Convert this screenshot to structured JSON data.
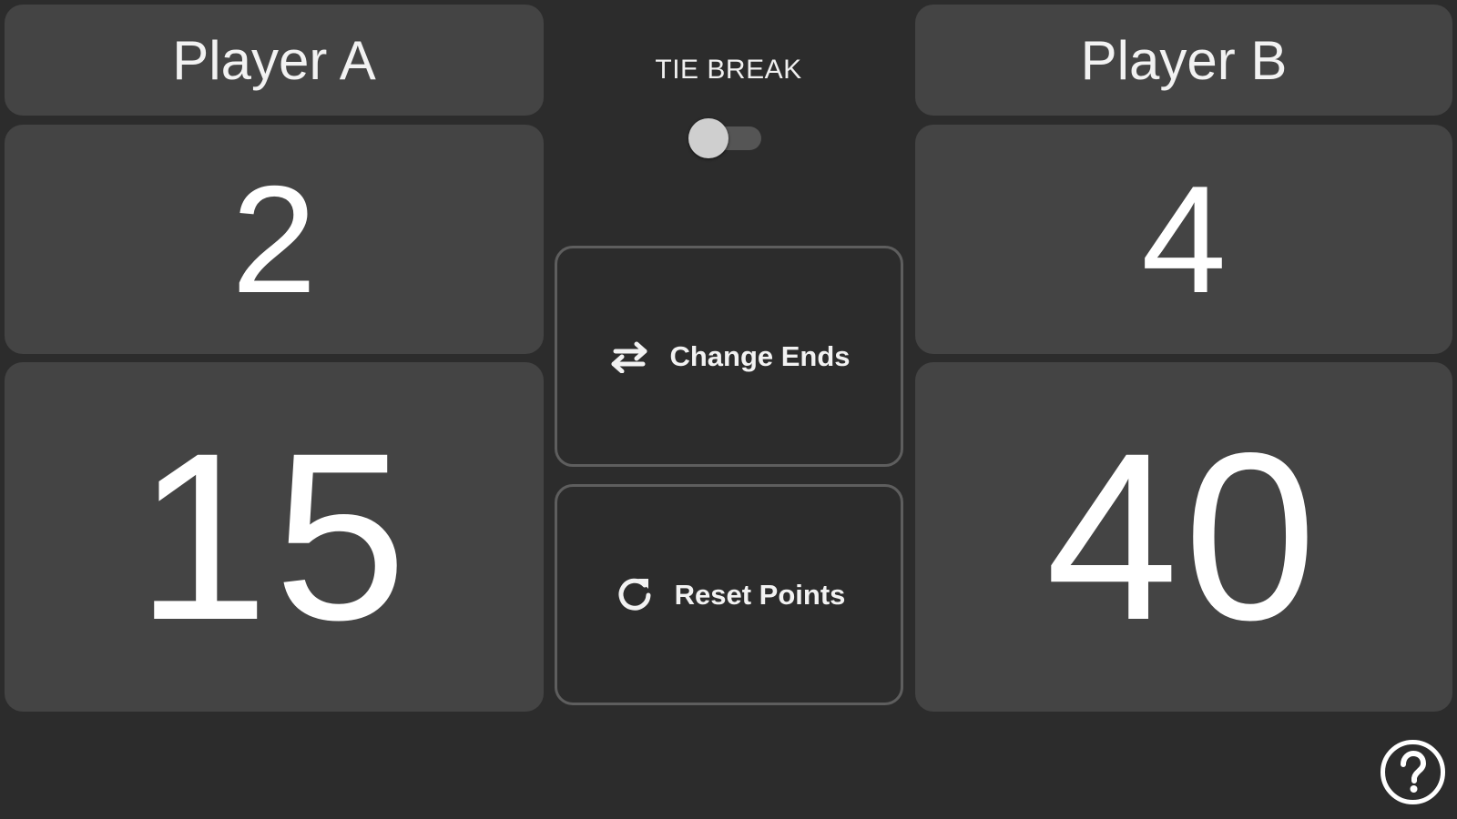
{
  "player_a": {
    "name": "Player A",
    "games": "2",
    "points": "15"
  },
  "player_b": {
    "name": "Player B",
    "games": "4",
    "points": "40"
  },
  "tie_break": {
    "label": "TIE BREAK",
    "enabled": false
  },
  "actions": {
    "change_ends_label": "Change Ends",
    "change_ends_icon": "swap-horiz-icon",
    "reset_points_label": "Reset Points",
    "reset_points_icon": "refresh-icon"
  },
  "help": {
    "icon": "help-circle-icon"
  },
  "colors": {
    "background": "#2c2c2c",
    "panel": "#444444",
    "button_border": "#5e5e5e",
    "text": "#ffffff"
  }
}
